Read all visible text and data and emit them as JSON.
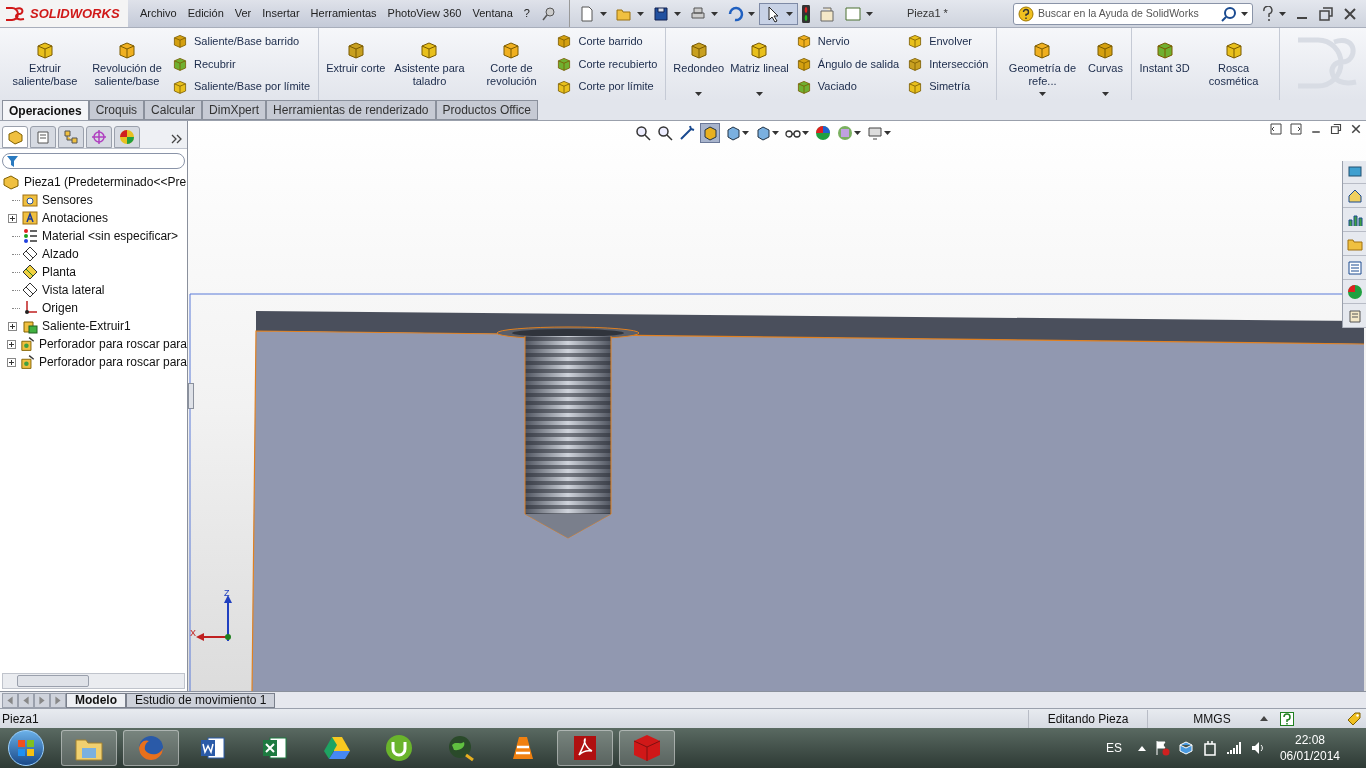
{
  "logo_text": "SOLIDWORKS",
  "menu": [
    "Archivo",
    "Edición",
    "Ver",
    "Insertar",
    "Herramientas",
    "PhotoView 360",
    "Ventana",
    "?"
  ],
  "document_title": "Pieza1 *",
  "search": {
    "placeholder": "Buscar en la Ayuda de SolidWorks"
  },
  "ribbon": [
    {
      "items": [
        {
          "kind": "large",
          "label": "Extruir saliente/base",
          "dropdown": false
        },
        {
          "kind": "large",
          "label": "Revolución de saliente/base",
          "dropdown": false
        },
        {
          "kind": "stack",
          "commands": [
            "Saliente/Base barrido",
            "Recubrir",
            "Saliente/Base por límite"
          ]
        }
      ]
    },
    {
      "items": [
        {
          "kind": "large",
          "label": "Extruir corte",
          "dropdown": false
        },
        {
          "kind": "large",
          "label": "Asistente para taladro",
          "dropdown": false
        },
        {
          "kind": "large",
          "label": "Corte de revolución",
          "dropdown": false
        },
        {
          "kind": "stack",
          "commands": [
            "Corte barrido",
            "Corte recubierto",
            "Corte por límite"
          ]
        }
      ]
    },
    {
      "items": [
        {
          "kind": "large",
          "label": "Redondeo",
          "dropdown": true
        },
        {
          "kind": "large",
          "label": "Matriz lineal",
          "dropdown": true
        },
        {
          "kind": "stack",
          "commands": [
            "Nervio",
            "Ángulo de salida",
            "Vaciado"
          ]
        },
        {
          "kind": "stack",
          "commands": [
            "Envolver",
            "Intersección",
            "Simetría"
          ]
        }
      ]
    },
    {
      "items": [
        {
          "kind": "large",
          "label": "Geometría de refe...",
          "dropdown": true
        },
        {
          "kind": "large",
          "label": "Curvas",
          "dropdown": true
        }
      ]
    },
    {
      "items": [
        {
          "kind": "large",
          "label": "Instant 3D",
          "dropdown": false
        },
        {
          "kind": "large",
          "label": "Rosca cosmética",
          "dropdown": false
        }
      ]
    }
  ],
  "command_tabs": [
    {
      "label": "Operaciones",
      "selected": true
    },
    {
      "label": "Croquis",
      "selected": false
    },
    {
      "label": "Calcular",
      "selected": false
    },
    {
      "label": "DimXpert",
      "selected": false
    },
    {
      "label": "Herramientas de renderizado",
      "selected": false
    },
    {
      "label": "Productos Office",
      "selected": false
    }
  ],
  "panel_tabs": [
    {
      "selected": true
    },
    {
      "selected": false
    },
    {
      "selected": false
    },
    {
      "selected": false
    },
    {
      "selected": false
    }
  ],
  "feature_tree": {
    "label": "Pieza1  (Predeterminado<<Pre",
    "children": [
      {
        "kind": "sensor",
        "label": "Sensores",
        "expandable": false
      },
      {
        "kind": "annotation",
        "label": "Anotaciones",
        "expandable": true
      },
      {
        "kind": "material",
        "label": "Material <sin especificar>",
        "expandable": false
      },
      {
        "kind": "plane",
        "label": "Alzado",
        "expandable": false
      },
      {
        "kind": "plane-selected",
        "label": "Planta",
        "expandable": false
      },
      {
        "kind": "plane",
        "label": "Vista lateral",
        "expandable": false
      },
      {
        "kind": "origin",
        "label": "Origen",
        "expandable": false
      },
      {
        "kind": "extrude",
        "label": "Saliente-Extruir1",
        "expandable": true
      },
      {
        "kind": "hole",
        "label": "Perforador para roscar para",
        "expandable": true
      },
      {
        "kind": "hole",
        "label": "Perforador para roscar para",
        "expandable": true
      }
    ]
  },
  "triad": {
    "z_label": "Z",
    "x_label": "X"
  },
  "bottom_tabs": [
    {
      "label": "Modelo",
      "selected": true
    },
    {
      "label": "Estudio de movimiento 1",
      "selected": false
    }
  ],
  "status_bar": {
    "document": "Pieza1",
    "mode": "Editando Pieza",
    "units": "MMGS"
  },
  "taskbar": {
    "apps": [
      {
        "kind": "explorer",
        "running": true
      },
      {
        "kind": "firefox",
        "running": true
      },
      {
        "kind": "word",
        "running": false
      },
      {
        "kind": "excel",
        "running": false
      },
      {
        "kind": "drive",
        "running": false
      },
      {
        "kind": "torrent",
        "running": false
      },
      {
        "kind": "globe",
        "running": false
      },
      {
        "kind": "vlc",
        "running": false
      },
      {
        "kind": "acrobat",
        "running": true
      },
      {
        "kind": "solidworks",
        "running": true
      }
    ],
    "language": "ES",
    "time": "22:08",
    "date": "06/01/2014"
  }
}
